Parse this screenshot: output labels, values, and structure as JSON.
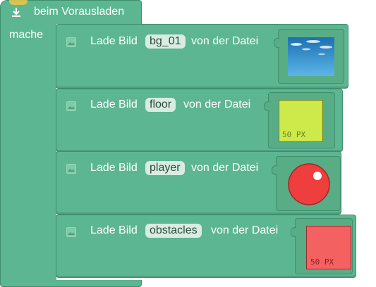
{
  "event_block": {
    "label": "beim Vorausladen",
    "body_label": "mache"
  },
  "load_blocks": [
    {
      "prefix": "Lade Bild",
      "name": "bg_01",
      "suffix": "von der Datei",
      "image": "sky-background"
    },
    {
      "prefix": "Lade Bild",
      "name": "floor",
      "suffix": "von der Datei",
      "image": "green-square",
      "image_text": "50 PX"
    },
    {
      "prefix": "Lade Bild",
      "name": "player",
      "suffix": "von der Datei",
      "image": "red-circle"
    },
    {
      "prefix": "Lade Bild",
      "name": "obstacles",
      "suffix": "von der Datei",
      "image": "red-square",
      "image_text": "50 PX"
    }
  ],
  "colors": {
    "block": "#5cb691",
    "block_border": "#3f8f6c",
    "field_bg": "#d8ece2",
    "floor_image": "#cde94a",
    "player_image": "#ef3e3e",
    "obstacles_image": "#f46161",
    "sky_image": "#2d86c8"
  }
}
